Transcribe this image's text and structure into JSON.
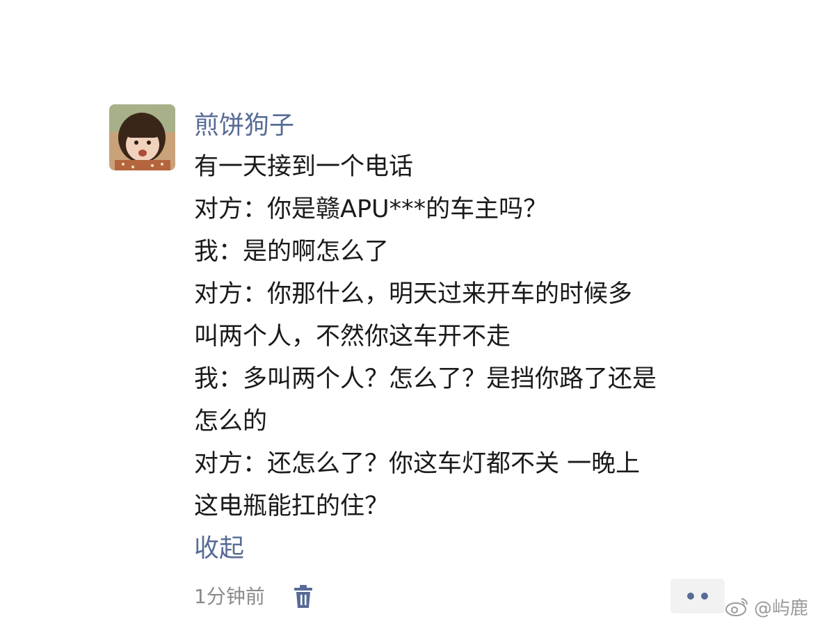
{
  "post": {
    "username": "煎饼狗子",
    "lines": [
      "有一天接到一个电话",
      "对方：你是赣APU***的车主吗？",
      "我：是的啊怎么了",
      "对方：你那什么，明天过来开车的时候多",
      "叫两个人，不然你这车开不走",
      "我：多叫两个人？怎么了？是挡你路了还是",
      "怎么的",
      "对方：还怎么了？你这车灯都不关 一晚上",
      "这电瓶能扛的住？"
    ],
    "collapse_label": "收起",
    "timestamp": "1分钟前"
  },
  "icons": {
    "avatar": "avatar-photo",
    "delete": "trash-icon",
    "more": "more-dots-icon",
    "watermark_logo": "weibo-logo"
  },
  "watermark": {
    "text": "@屿鹿"
  },
  "colors": {
    "link": "#576b95",
    "text": "#1a1a1a",
    "meta": "#8a8a8a",
    "more_bg": "#f2f2f2"
  }
}
